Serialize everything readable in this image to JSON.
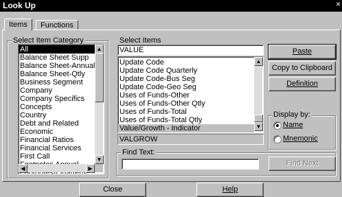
{
  "window": {
    "title": "Look Up",
    "close_glyph": "×"
  },
  "tabs": [
    {
      "label": "Items",
      "active": true
    },
    {
      "label": "Functions",
      "active": false
    }
  ],
  "category_group": {
    "legend": "Select Item Category",
    "items": [
      "All",
      "Balance Sheet Supp",
      "Balance Sheet-Annual",
      "Balance Sheet-Qtly",
      "Business Segment",
      "Company",
      "Company Specifics",
      "Concepts",
      "Country",
      "Debt and Related",
      "Economic",
      "Financial Ratios",
      "Financial Services",
      "First Call",
      "Footnotes Annual",
      "Footnotes-Quarterly"
    ],
    "selected_index": 0
  },
  "items_group": {
    "legend": "Select Items",
    "search_value": "VALUE",
    "items": [
      "Update Code",
      "Update Code Quarterly",
      "Update Code-Bus Seg",
      "Update Code-Geo Seg",
      "Uses of Funds-Other",
      "Uses of Funds-Other Qtly",
      "Uses of Funds-Total",
      "Uses of Funds-Total Qtly",
      "Value/Growth - Indicator"
    ],
    "selected_index": 8,
    "mnemonic": "VALGROW"
  },
  "buttons": {
    "paste": "Paste",
    "copy": "Copy to Clipboard",
    "definition": "Definition",
    "find_next": "Find Next",
    "close": "Close",
    "help": "Help"
  },
  "display_by": {
    "legend": "Display by:",
    "options": [
      {
        "label": "Name",
        "checked": true
      },
      {
        "label": "Mnemonic",
        "checked": false
      }
    ]
  },
  "find_text": {
    "legend": "Find Text:",
    "value": ""
  }
}
